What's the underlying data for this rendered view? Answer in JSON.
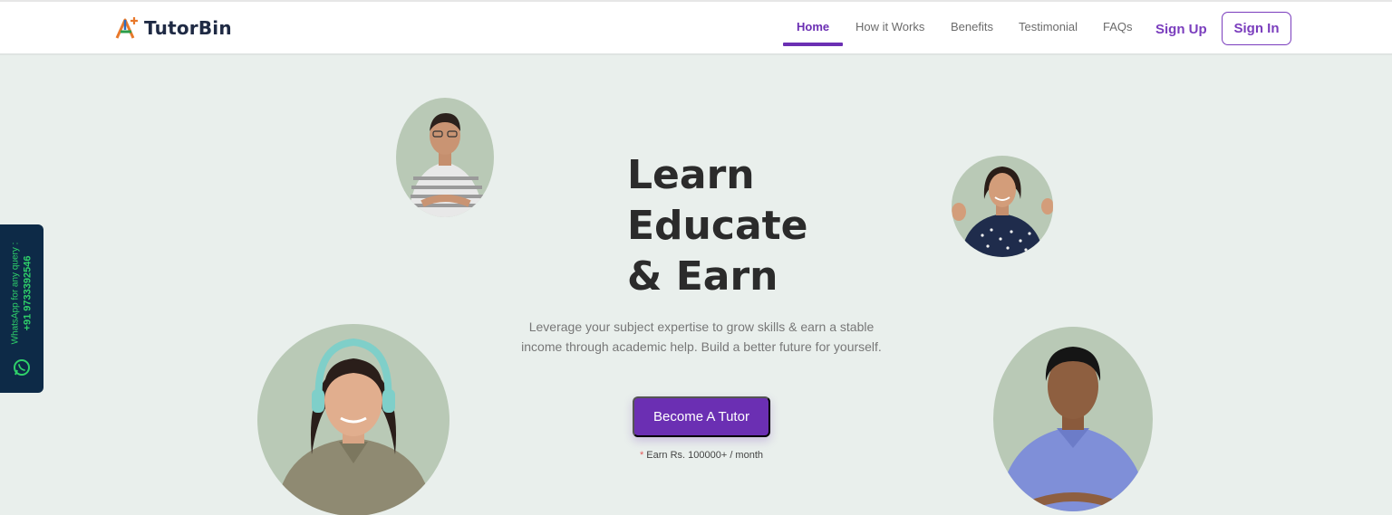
{
  "brand": {
    "name": "TutorBin"
  },
  "nav": {
    "items": [
      {
        "label": "Home",
        "active": true
      },
      {
        "label": "How it Works",
        "active": false
      },
      {
        "label": "Benefits",
        "active": false
      },
      {
        "label": "Testimonial",
        "active": false
      },
      {
        "label": "FAQs",
        "active": false
      }
    ],
    "signup_label": "Sign Up",
    "signin_label": "Sign In"
  },
  "hero": {
    "title_lines": [
      "Learn",
      "Educate",
      "& Earn"
    ],
    "description": "Leverage your subject expertise to grow skills & earn a stable income through academic help. Build a better future for yourself.",
    "cta_label": "Become A Tutor",
    "earn_note": "Earn Rs. 100000+ / month",
    "earn_marker": "*"
  },
  "whatsapp": {
    "label": "WhatsApp for any query :",
    "number": "+91 9733392546"
  },
  "portraits": [
    {
      "name": "tutor-portrait-striped-shirt"
    },
    {
      "name": "tutor-portrait-polka-dot"
    },
    {
      "name": "tutor-portrait-headphones"
    },
    {
      "name": "tutor-portrait-blue-shirt"
    }
  ],
  "colors": {
    "accent": "#6b2fb3",
    "background": "#e9efec",
    "blob": "#b9c9b6",
    "whatsapp_panel": "#0d2a47",
    "whatsapp_text": "#2fd06a"
  }
}
